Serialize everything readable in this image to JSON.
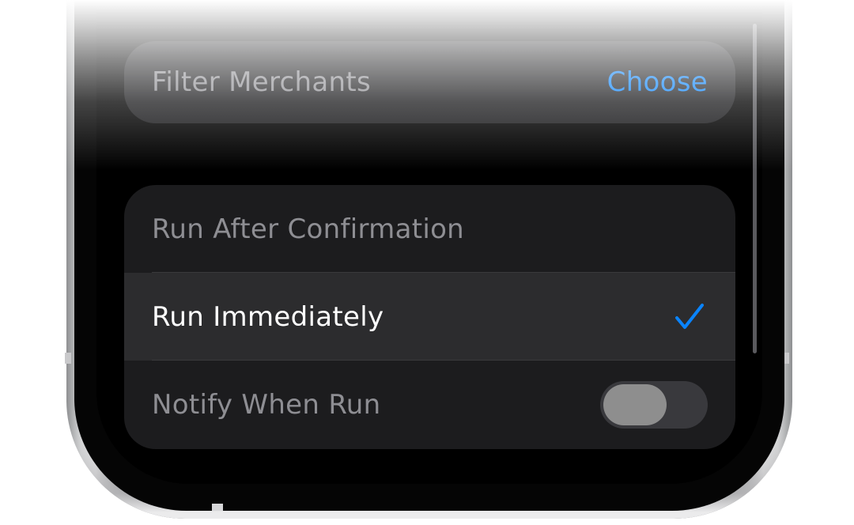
{
  "filter": {
    "label": "Filter Merchants",
    "action": "Choose"
  },
  "options": [
    {
      "label": "Run After Confirmation",
      "selected": false
    },
    {
      "label": "Run Immediately",
      "selected": true
    },
    {
      "label": "Notify When Run",
      "control": "toggle",
      "on": false
    }
  ],
  "colors": {
    "accent": "#0a84ff",
    "card": "#1c1c1e",
    "selected_row": "#2c2c2e",
    "toggle_off_track": "#39393d"
  },
  "icons": {
    "selected_marker": "checkmark-icon"
  }
}
